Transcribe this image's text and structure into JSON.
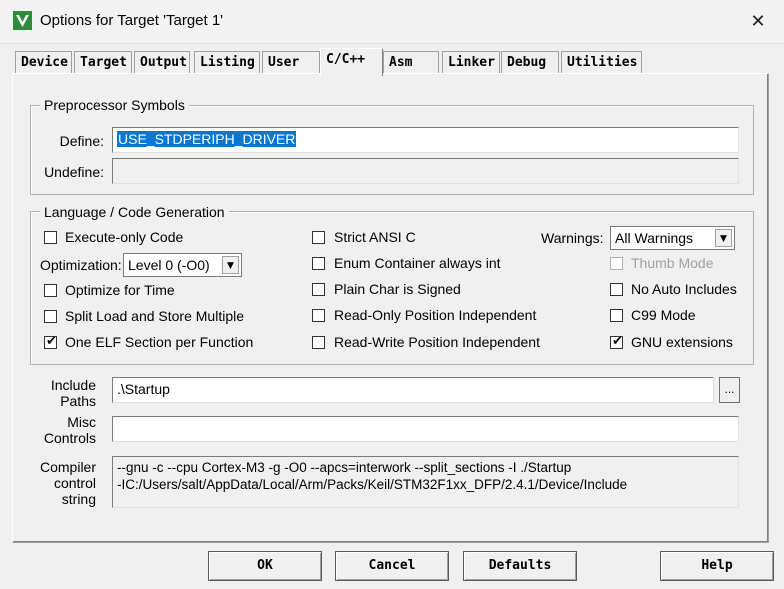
{
  "window": {
    "title": "Options for Target 'Target 1'",
    "close": "✕"
  },
  "tabs": [
    "Device",
    "Target",
    "Output",
    "Listing",
    "User",
    "C/C++",
    "Asm",
    "Linker",
    "Debug",
    "Utilities"
  ],
  "active_tab": "C/C++",
  "preprocessor": {
    "group_label": "Preprocessor Symbols",
    "define_label": "Define:",
    "define_value": "USE_STDPERIPH_DRIVER",
    "undefine_label": "Undefine:",
    "undefine_value": ""
  },
  "language": {
    "group_label": "Language / Code Generation",
    "execute_only": {
      "label": "Execute-only Code",
      "checked": false
    },
    "optimization_label": "Optimization:",
    "optimization_value": "Level 0 (-O0)",
    "optimize_time": {
      "label": "Optimize for Time",
      "checked": false
    },
    "split_load": {
      "label": "Split Load and Store Multiple",
      "checked": false
    },
    "one_elf": {
      "label": "One ELF Section per Function",
      "checked": true
    },
    "strict_ansi": {
      "label": "Strict ANSI C",
      "checked": false
    },
    "enum_container": {
      "label": "Enum Container always int",
      "checked": false
    },
    "plain_char": {
      "label": "Plain Char is Signed",
      "checked": false
    },
    "ro_pi": {
      "label": "Read-Only Position Independent",
      "checked": false
    },
    "rw_pi": {
      "label": "Read-Write Position Independent",
      "checked": false
    },
    "warnings_label": "Warnings:",
    "warnings_value": "All Warnings",
    "thumb_mode": {
      "label": "Thumb Mode",
      "checked": false,
      "disabled": true
    },
    "no_auto_includes": {
      "label": "No Auto Includes",
      "checked": false
    },
    "c99_mode": {
      "label": "C99 Mode",
      "checked": false
    },
    "gnu_ext": {
      "label": "GNU extensions",
      "checked": true
    }
  },
  "include_paths": {
    "label_line1": "Include",
    "label_line2": "Paths",
    "value": ".\\Startup",
    "browse": "..."
  },
  "misc_controls": {
    "label_line1": "Misc",
    "label_line2": "Controls",
    "value": ""
  },
  "compiler_string": {
    "label_line1": "Compiler",
    "label_line2": "control",
    "label_line3": "string",
    "line1": "--gnu -c --cpu Cortex-M3 -g -O0 --apcs=interwork --split_sections -I ./Startup",
    "line2": "-IC:/Users/salt/AppData/Local/Arm/Packs/Keil/STM32F1xx_DFP/2.4.1/Device/Include"
  },
  "buttons": {
    "ok": "OK",
    "cancel": "Cancel",
    "defaults": "Defaults",
    "help": "Help"
  },
  "colors": {
    "selection": "#0078d7",
    "dialog_bg": "#f0f0f0",
    "disabled_text": "#a0a0a0"
  }
}
